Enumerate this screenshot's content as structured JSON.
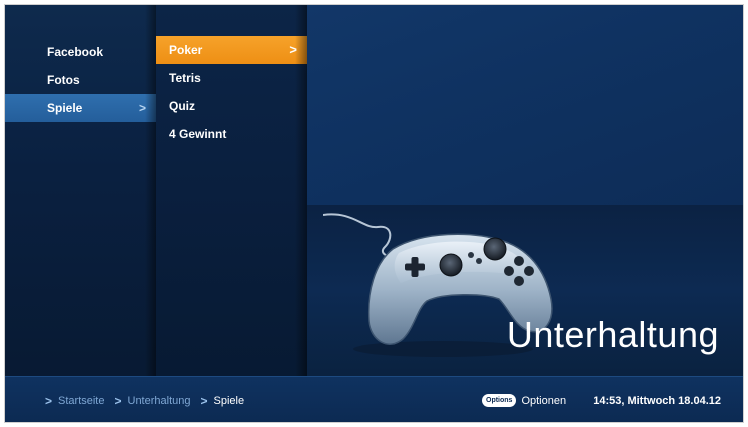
{
  "menu_level1": {
    "items": [
      {
        "label": "Facebook",
        "active": false
      },
      {
        "label": "Fotos",
        "active": false
      },
      {
        "label": "Spiele",
        "active": true
      }
    ],
    "chevron": ">"
  },
  "menu_level2": {
    "items": [
      {
        "label": "Poker",
        "active": true
      },
      {
        "label": "Tetris",
        "active": false
      },
      {
        "label": "Quiz",
        "active": false
      },
      {
        "label": "4 Gewinnt",
        "active": false
      }
    ],
    "chevron": ">"
  },
  "preview": {
    "category_title": "Unterhaltung",
    "image_icon": "gamepad-icon"
  },
  "footer": {
    "breadcrumb": [
      "Startseite",
      "Unterhaltung",
      "Spiele"
    ],
    "options_badge": "Options",
    "options_label": "Optionen",
    "clock": "14:53, Mittwoch 18.04.12"
  },
  "colors": {
    "accent_orange": "#f39a1f",
    "selection_blue": "#2a67a6",
    "background": "#0b1c33"
  }
}
